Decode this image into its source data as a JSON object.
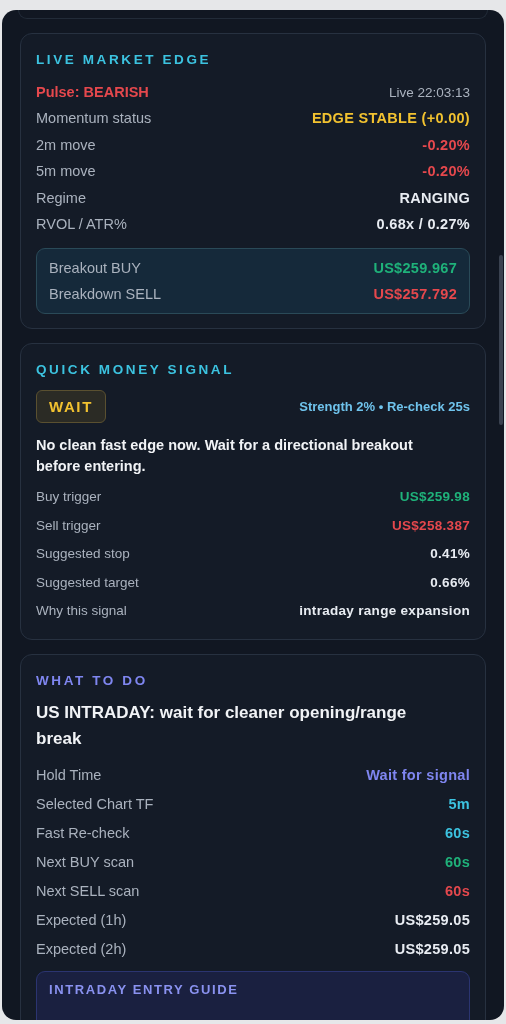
{
  "live_market_edge": {
    "title": "LIVE MARKET EDGE",
    "pulse": "Pulse: BEARISH",
    "live_time": "Live 22:03:13",
    "rows": [
      {
        "label": "Momentum status",
        "value": "EDGE STABLE (+0.00)",
        "color": "#f2c230"
      },
      {
        "label": "2m move",
        "value": "-0.20%",
        "color": "#e5484d"
      },
      {
        "label": "5m move",
        "value": "-0.20%",
        "color": "#e5484d"
      },
      {
        "label": "Regime",
        "value": "RANGING",
        "color": "#e8ecf2"
      },
      {
        "label": "RVOL / ATR%",
        "value": "0.68x / 0.27%",
        "color": "#e8ecf2"
      }
    ],
    "levels": [
      {
        "label": "Breakout BUY",
        "value": "US$259.967",
        "color": "#1fb27a"
      },
      {
        "label": "Breakdown SELL",
        "value": "US$257.792",
        "color": "#e5484d"
      }
    ]
  },
  "quick_money_signal": {
    "title": "QUICK MONEY SIGNAL",
    "badge": "WAIT",
    "meta": "Strength 2% • Re-check 25s",
    "message": "No clean fast edge now. Wait for a directional breakout before entering.",
    "rows": [
      {
        "label": "Buy trigger",
        "value": "US$259.98",
        "color": "#1fb27a"
      },
      {
        "label": "Sell trigger",
        "value": "US$258.387",
        "color": "#e5484d"
      },
      {
        "label": "Suggested stop",
        "value": "0.41%",
        "color": "#e8ecf2"
      },
      {
        "label": "Suggested target",
        "value": "0.66%",
        "color": "#e8ecf2"
      },
      {
        "label": "Why this signal",
        "value": "intraday range expansion",
        "color": "#e8ecf2"
      }
    ]
  },
  "what_to_do": {
    "title": "WHAT TO DO",
    "headline": "US INTRADAY: wait for cleaner opening/range break",
    "rows": [
      {
        "label": "Hold Time",
        "value": "Wait for signal",
        "color": "#7f86f0"
      },
      {
        "label": "Selected Chart TF",
        "value": "5m",
        "color": "#3cc3e0"
      },
      {
        "label": "Fast Re-check",
        "value": "60s",
        "color": "#3cc3e0"
      },
      {
        "label": "Next BUY scan",
        "value": "60s",
        "color": "#1fb27a"
      },
      {
        "label": "Next SELL scan",
        "value": "60s",
        "color": "#e5484d"
      },
      {
        "label": "Expected (1h)",
        "value": "US$259.05",
        "color": "#e8ecf2"
      },
      {
        "label": "Expected (2h)",
        "value": "US$259.05",
        "color": "#e8ecf2"
      }
    ],
    "guide": {
      "title": "INTRADAY ENTRY GUIDE"
    }
  }
}
